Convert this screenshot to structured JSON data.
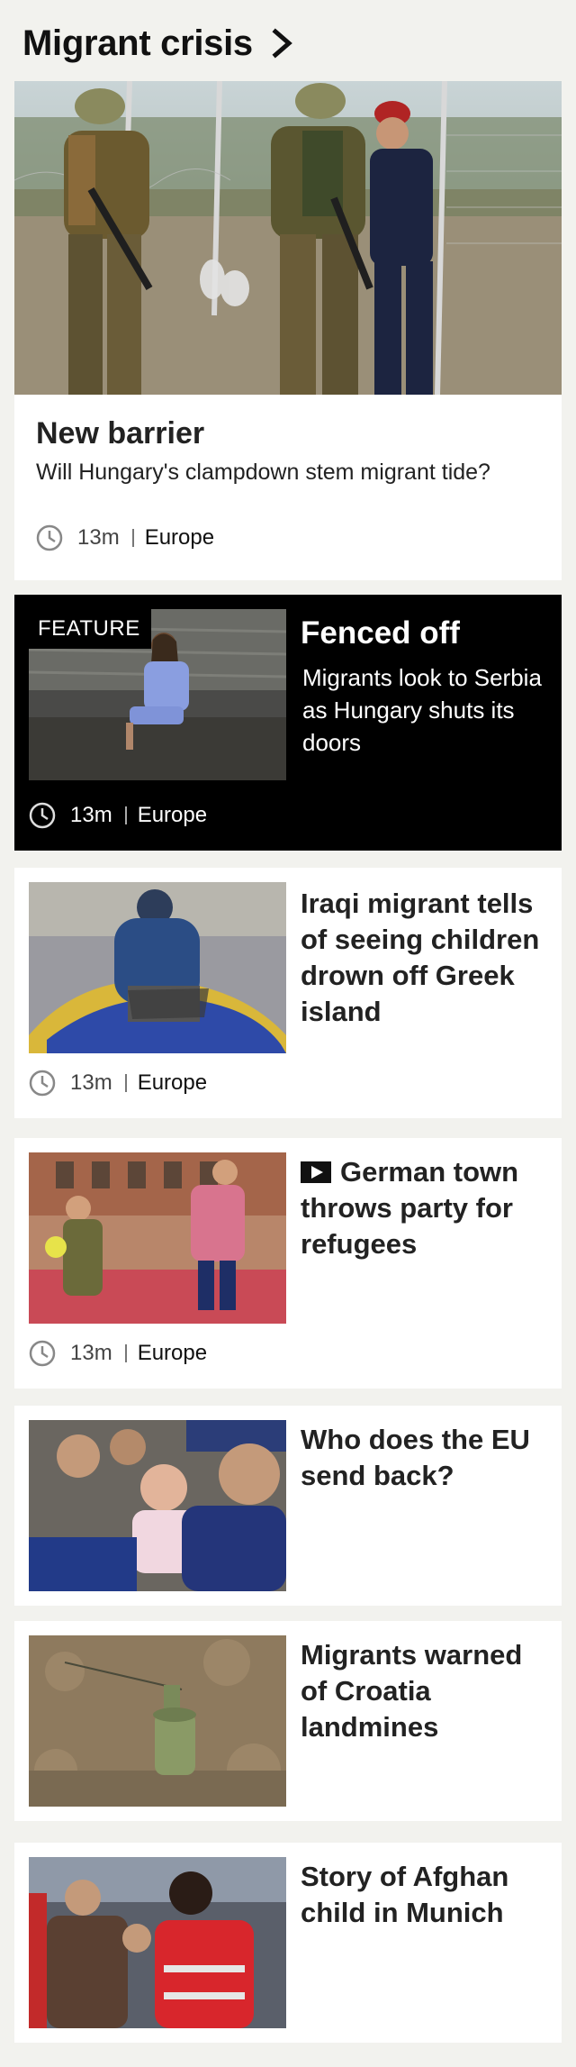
{
  "header": {
    "title": "Migrant crisis",
    "arrow_icon": "chevron-right-icon"
  },
  "hero": {
    "image_alt": "Hungarian soldiers and police beside razor-wire border fence",
    "title": "New barrier",
    "summary": "Will Hungary's clampdown stem migrant tide?",
    "time": "13m",
    "section": "Europe"
  },
  "feature": {
    "badge": "FEATURE",
    "title": "Fenced off",
    "summary": "Migrants look to Serbia as Hungary shuts its doors",
    "time": "13m",
    "section": "Europe"
  },
  "stories": [
    {
      "title": "Iraqi migrant tells of seeing children drown off Greek island",
      "time": "13m",
      "section": "Europe",
      "has_video": false
    },
    {
      "title": "German town throws party for refugees",
      "time": "13m",
      "section": "Europe",
      "has_video": true
    },
    {
      "title": "Who does the EU send back?",
      "has_video": false
    },
    {
      "title": "Migrants warned of Croatia landmines",
      "has_video": false
    },
    {
      "title": "Story of Afghan child in Munich",
      "has_video": false
    }
  ],
  "colors": {
    "page_bg": "#f2f2ee",
    "card_bg": "#ffffff",
    "feature_bg": "#000000",
    "text": "#222222"
  }
}
